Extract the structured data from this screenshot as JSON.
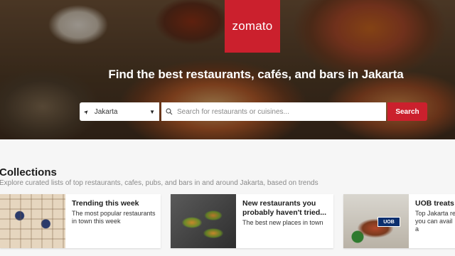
{
  "brand": {
    "logo_text": "zomato",
    "brand_color": "#cb202d"
  },
  "hero": {
    "headline": "Find the best restaurants, cafés, and bars in Jakarta"
  },
  "search": {
    "location_value": "Jakarta",
    "query_placeholder": "Search for restaurants or cuisines...",
    "button_label": "Search"
  },
  "collections": {
    "title": "Collections",
    "subtitle": "Explore curated lists of top restaurants, cafes, pubs, and bars in and around Jakarta, based on trends",
    "cards": [
      {
        "title": "Trending this week",
        "description": "The most popular restaurants in town this week"
      },
      {
        "title": "New restaurants you probably haven't tried...",
        "description": "The best new places in town"
      },
      {
        "title": "UOB treats",
        "description": "Top Jakarta re you can avail a",
        "badge": "UOB"
      }
    ]
  },
  "icons": {
    "location": "location-arrow-icon",
    "dropdown": "chevron-down-icon",
    "search": "search-icon"
  }
}
